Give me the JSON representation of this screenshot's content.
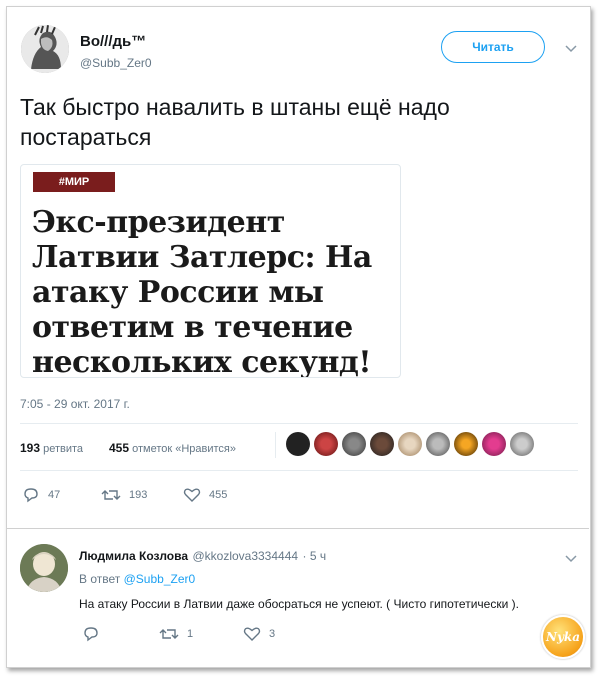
{
  "tweet": {
    "author_name": "Во///дь™",
    "author_handle": "@Subb_Zer0",
    "follow_label": "Читать",
    "text": "Так быстро навалить в штаны ещё надо постараться",
    "card": {
      "tag": "#МИР",
      "headline": "Экс-президент Латвии Затлерс: На атаку России мы ответим в течение нескольких секунд!"
    },
    "timestamp": "7:05 - 29 окт. 2017 г.",
    "stats": {
      "retweets_count": "193",
      "retweets_label": "ретвита",
      "likes_count": "455",
      "likes_label": "отметок «Нравится»"
    },
    "actions": {
      "replies": "47",
      "retweets": "193",
      "likes": "455"
    }
  },
  "reply": {
    "author_name": "Людмила Козлова",
    "author_handle": "@kkozlova3334444",
    "time": "· 5 ч",
    "reply_to_prefix": "В ответ",
    "reply_to_handle": "@Subb_Zer0",
    "text": "На атаку России в Латвии даже обосраться не успеют. ( Чисто гипотетически ).",
    "actions": {
      "replies": "",
      "retweets": "1",
      "likes": "3"
    }
  },
  "watermark": "Nyka",
  "colors": {
    "accent": "#1da1f2",
    "tag_bg": "#7a1d1d",
    "muted": "#657786"
  }
}
